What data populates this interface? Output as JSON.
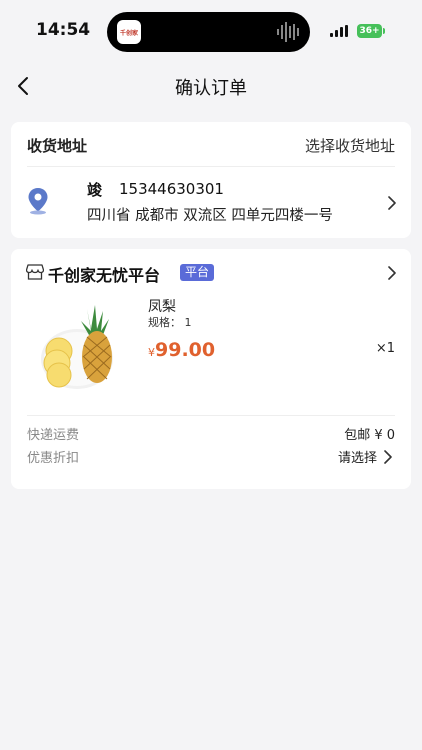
{
  "status_bar": {
    "time": "14:54",
    "battery": "36+",
    "app_logo_text": "千创家"
  },
  "header": {
    "title": "确认订单"
  },
  "address": {
    "section_label": "收货地址",
    "select_label": "选择收货地址",
    "name": "竣",
    "phone": "15344630301",
    "line": "四川省 成都市 双流区 四单元四楼一号"
  },
  "shop": {
    "name": "千创家无忧平台",
    "badge": "平台",
    "product": {
      "name": "凤梨",
      "spec": "规格：  1",
      "currency": "¥",
      "price": "99.00",
      "quantity": "×1"
    }
  },
  "fees": {
    "shipping_label": "快递运费",
    "shipping_value": "包邮 ¥ 0",
    "discount_label": "优惠折扣",
    "discount_value": "请选择"
  },
  "colors": {
    "accent": "#e0612e",
    "badge": "#5a6bd8",
    "location_icon": "#5b79c9"
  }
}
